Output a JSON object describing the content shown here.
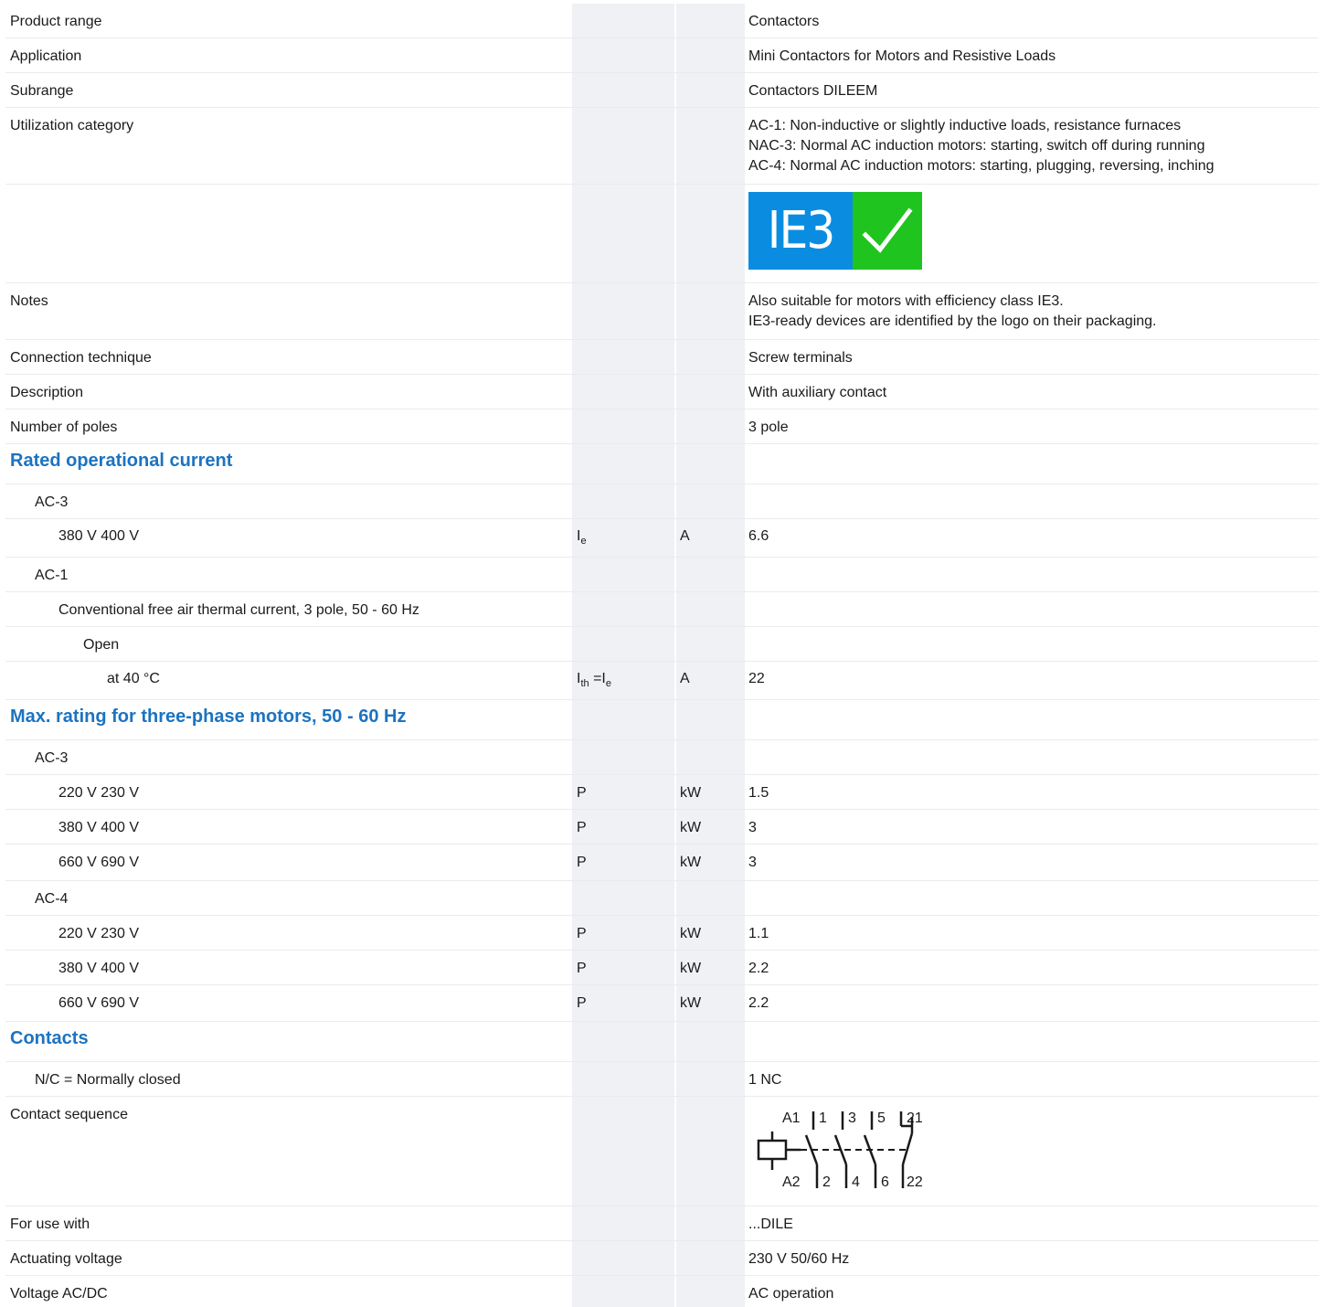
{
  "rows": [
    {
      "label": "Product range",
      "symbol": "",
      "unit": "",
      "value": "Contactors"
    },
    {
      "label": "Application",
      "symbol": "",
      "unit": "",
      "value": "Mini Contactors for Motors and Resistive Loads"
    },
    {
      "label": "Subrange",
      "symbol": "",
      "unit": "",
      "value": "Contactors DILEEM"
    },
    {
      "label": "Utilization category",
      "symbol": "",
      "unit": "",
      "value_lines": [
        "AC-1: Non-inductive or slightly inductive loads, resistance furnaces",
        "NAC-3: Normal AC induction motors: starting, switch off during running",
        "AC-4: Normal AC induction motors: starting, plugging, reversing, inching"
      ]
    },
    {
      "logo_text": "IE3",
      "logo_colors": {
        "blue": "#0a8de0",
        "green": "#1fc41f"
      }
    },
    {
      "label": "Notes",
      "symbol": "",
      "unit": "",
      "value_lines": [
        "Also suitable for motors with efficiency class IE3.",
        "IE3-ready devices are identified by the logo on their packaging."
      ]
    },
    {
      "label": "Connection technique",
      "value": "Screw terminals"
    },
    {
      "label": "Description",
      "value": "With auxiliary contact"
    },
    {
      "label": "Number of poles",
      "value": "3 pole"
    },
    {
      "section": "Rated operational current"
    },
    {
      "label": "AC-3",
      "indent": 1
    },
    {
      "label": "380 V 400 V",
      "indent": 2,
      "symbol_main": "I",
      "symbol_sub": "e",
      "unit": "A",
      "value": "6.6"
    },
    {
      "label": "AC-1",
      "indent": 1
    },
    {
      "label": "Conventional free air thermal current, 3 pole, 50 - 60 Hz",
      "indent": 2
    },
    {
      "label": "Open",
      "indent": 3
    },
    {
      "label": "at 40 °C",
      "indent": 4,
      "symbol_main": "I",
      "symbol_sub": "th",
      "symbol_mid": " =I",
      "symbol_sub2": "e",
      "unit": "A",
      "value": "22"
    },
    {
      "section": "Max. rating for three-phase motors, 50 - 60 Hz"
    },
    {
      "label": "AC-3",
      "indent": 1
    },
    {
      "label": "220 V 230 V",
      "indent": 2,
      "symbol": "P",
      "unit": "kW",
      "value": "1.5"
    },
    {
      "label": "380 V 400 V",
      "indent": 2,
      "symbol": "P",
      "unit": "kW",
      "value": "3"
    },
    {
      "label": "660 V 690 V",
      "indent": 2,
      "symbol": "P",
      "unit": "kW",
      "value": "3"
    },
    {
      "label": "AC-4",
      "indent": 1
    },
    {
      "label": "220 V 230 V",
      "indent": 2,
      "symbol": "P",
      "unit": "kW",
      "value": "1.1"
    },
    {
      "label": "380 V 400 V",
      "indent": 2,
      "symbol": "P",
      "unit": "kW",
      "value": "2.2"
    },
    {
      "label": "660 V 690 V",
      "indent": 2,
      "symbol": "P",
      "unit": "kW",
      "value": "2.2"
    },
    {
      "section": "Contacts"
    },
    {
      "label": "N/C = Normally closed",
      "indent": 1,
      "value": "1 NC"
    },
    {
      "label": "Contact sequence",
      "diagram_labels": {
        "top": [
          "A1",
          "1",
          "3",
          "5",
          "21"
        ],
        "bottom": [
          "A2",
          "2",
          "4",
          "6",
          "22"
        ]
      }
    },
    {
      "label": "For use with",
      "value": "...DILE"
    },
    {
      "label": "Actuating voltage",
      "value": "230 V 50/60 Hz"
    },
    {
      "label": "Voltage AC/DC",
      "value": "AC operation"
    }
  ]
}
